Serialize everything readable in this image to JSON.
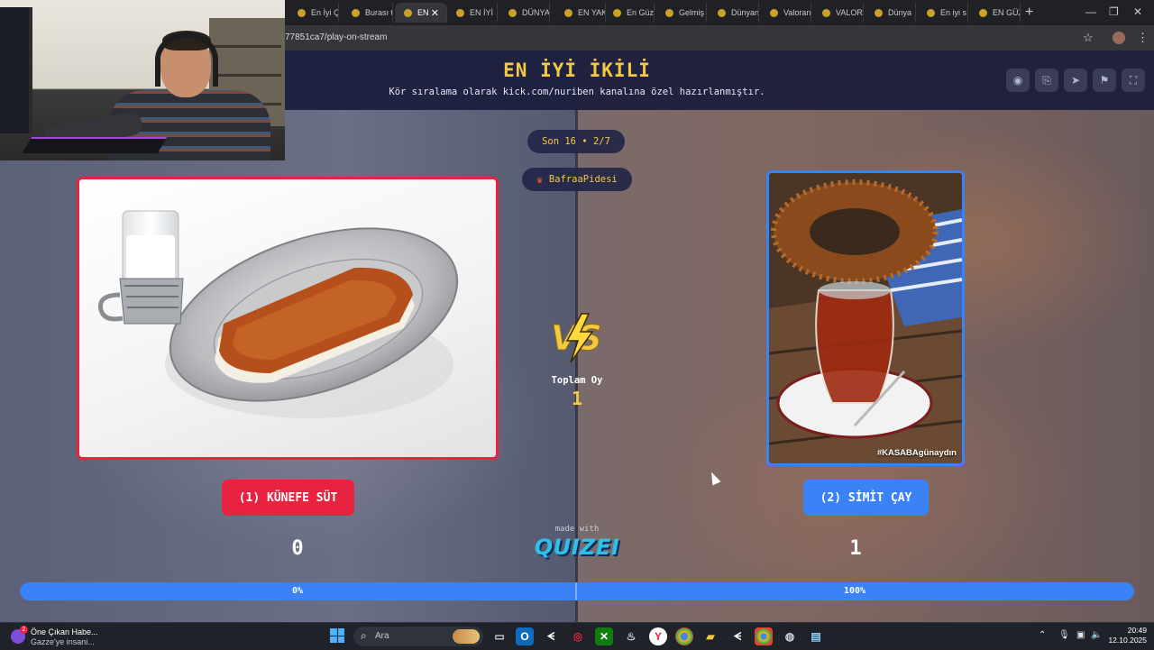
{
  "browser": {
    "tabs": [
      {
        "label": "En İyi Ç"
      },
      {
        "label": "Burası t"
      },
      {
        "label": "EN"
      },
      {
        "label": "EN İYİ"
      },
      {
        "label": "DÜNYA"
      },
      {
        "label": "EN YAK"
      },
      {
        "label": "En Güz"
      },
      {
        "label": "Gelmiş"
      },
      {
        "label": "Dünyan"
      },
      {
        "label": "Valoran"
      },
      {
        "label": "VALOR"
      },
      {
        "label": "Dünya"
      },
      {
        "label": "En iyi s"
      },
      {
        "label": "EN GÜZ"
      }
    ],
    "active_tab_index": 2,
    "url": "77851ca7/play-on-stream"
  },
  "header": {
    "title": "EN İYİ İKİLİ",
    "subtitle": "Kör sıralama olarak kick.com/nuriben kanalına özel hazırlanmıştır."
  },
  "round": {
    "label": "Son 16 • 2/7"
  },
  "voter": {
    "name": "BafraaPidesi"
  },
  "left_option": {
    "label": "(1) KÜNEFE SÜT",
    "score": "0",
    "percent_text": "0%",
    "share": 0.0,
    "color": "#e8233f"
  },
  "right_option": {
    "label": "(2) SİMİT ÇAY",
    "score": "1",
    "percent_text": "100%",
    "share": 1.0,
    "image_tag": "#KASABAgünaydın",
    "color": "#3b82f6"
  },
  "center": {
    "vs": "VS",
    "total_label": "Toplam Oy",
    "total_value": "1",
    "made_with": "made with",
    "brand": "QUIZEI"
  },
  "taskbar": {
    "news_badge": "2",
    "news_title": "Öne Çıkan Habe...",
    "news_subtitle": "Gazze'ye insani...",
    "search_placeholder": "Ara",
    "time": "20:49",
    "date": "12.10.2025"
  },
  "colors": {
    "accent_yellow": "#f5c842",
    "header_bg": "#1c1f40",
    "brand_cyan": "#2fc0e8"
  }
}
